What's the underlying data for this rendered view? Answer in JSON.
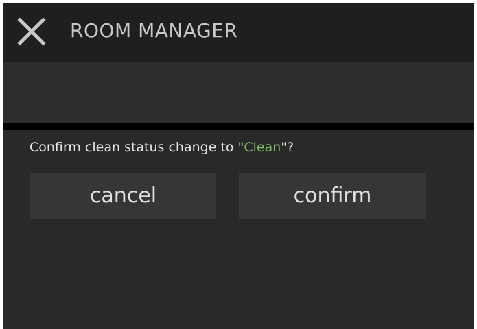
{
  "header": {
    "title": "ROOM MANAGER",
    "close_icon": "close-icon"
  },
  "dialog": {
    "prompt_prefix": "Confirm clean status change to \"",
    "status_value": "Clean",
    "prompt_suffix": "\"?",
    "cancel_label": "cancel",
    "confirm_label": "confirm"
  },
  "colors": {
    "background": "#2a2a2a",
    "header": "#1f1f1f",
    "divider": "#000000",
    "button": "#363636",
    "text": "#e6e6e6",
    "status_accent": "#7fbf6a"
  }
}
